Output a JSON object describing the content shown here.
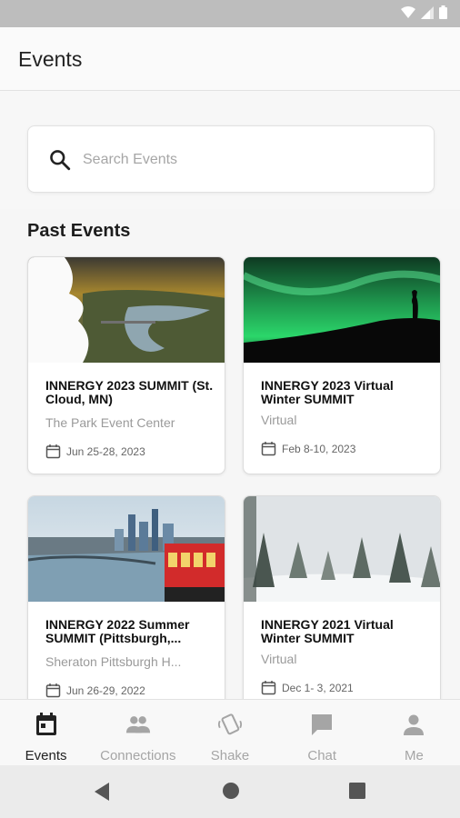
{
  "status_bar": {
    "icons": [
      "wifi-icon",
      "signal-icon",
      "battery-icon"
    ]
  },
  "app_bar": {
    "title": "Events"
  },
  "search": {
    "placeholder": "Search Events",
    "value": ""
  },
  "sections": {
    "past_events_title": "Past Events"
  },
  "events": [
    {
      "title": "INNERGY 2023 SUMMIT (St. Cloud, MN)",
      "venue": "The Park Event Center",
      "date": "Jun 25-28, 2023"
    },
    {
      "title": "INNERGY 2023 Virtual Winter SUMMIT",
      "venue": "Virtual",
      "date": "Feb  8-10, 2023"
    },
    {
      "title": "INNERGY 2022 Summer SUMMIT (Pittsburgh,...",
      "venue": "Sheraton Pittsburgh H...",
      "date": "Jun 26-29, 2022"
    },
    {
      "title": "INNERGY 2021 Virtual Winter SUMMIT",
      "venue": "Virtual",
      "date": "Dec  1- 3, 2021"
    }
  ],
  "bottom_nav": [
    {
      "label": "Events",
      "icon": "calendar-icon",
      "active": true
    },
    {
      "label": "Connections",
      "icon": "people-icon",
      "active": false
    },
    {
      "label": "Shake",
      "icon": "shake-phone-icon",
      "active": false
    },
    {
      "label": "Chat",
      "icon": "chat-bubble-icon",
      "active": false
    },
    {
      "label": "Me",
      "icon": "person-icon",
      "active": false
    }
  ],
  "colors": {
    "active_nav": "#222222",
    "inactive_nav": "#a5a5a5",
    "venue_text": "#9a9a9a",
    "aurora_green": "#2bd66a"
  }
}
